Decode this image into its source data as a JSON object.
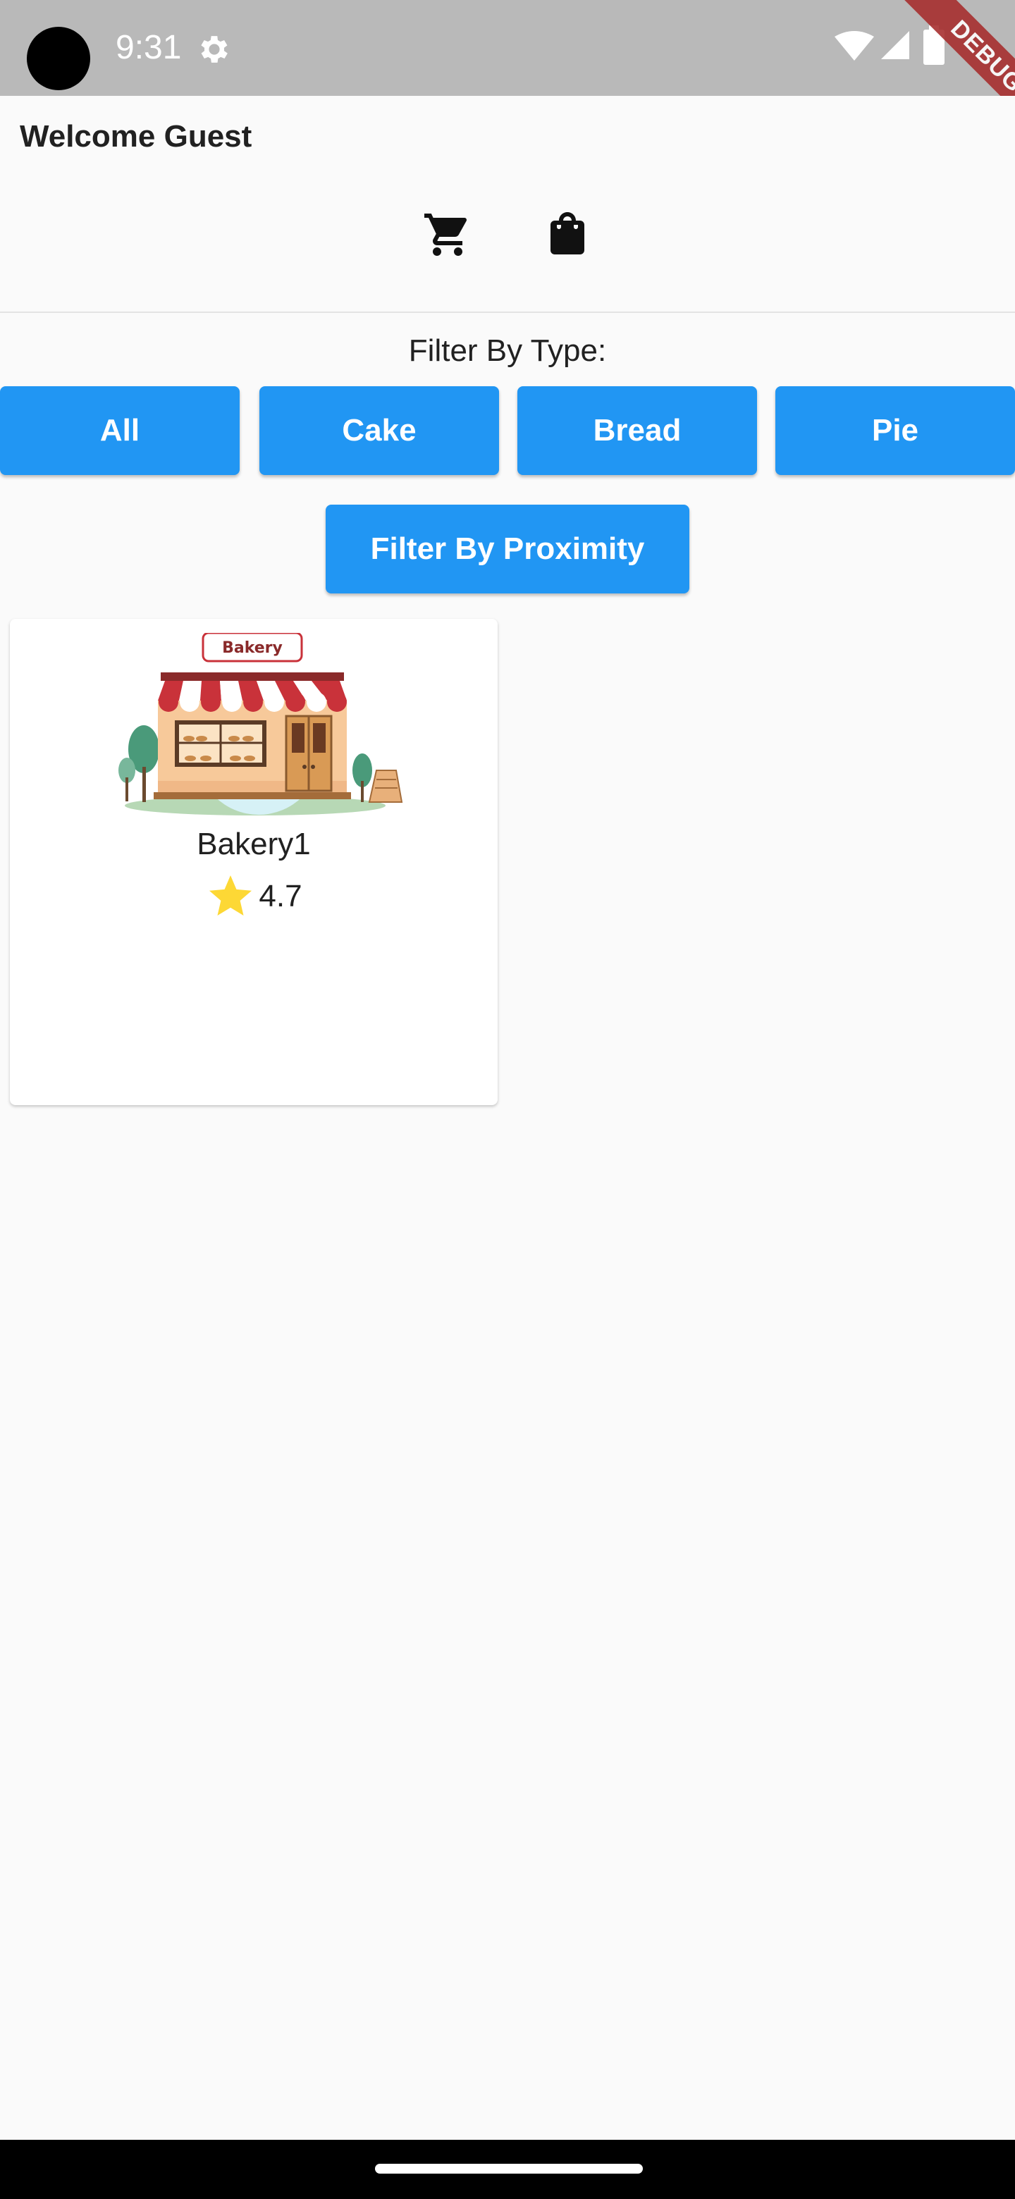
{
  "status_bar": {
    "time": "9:31",
    "icons": [
      "settings-icon",
      "wifi-icon",
      "signal-icon",
      "battery-icon"
    ]
  },
  "debug_banner": {
    "label": "DEBUG",
    "color": "#a62b2b"
  },
  "header": {
    "welcome": "Welcome Guest",
    "actions": [
      "cart-icon",
      "shopping-bag-icon"
    ]
  },
  "filters": {
    "type_label": "Filter By Type:",
    "types": [
      "All",
      "Cake",
      "Bread",
      "Pie"
    ],
    "proximity_label": "Filter By Proximity",
    "button_color": "#2196f3"
  },
  "bakeries": [
    {
      "image_sign": "Bakery",
      "name": "Bakery1",
      "rating": "4.7",
      "rating_icon": "star-icon"
    }
  ]
}
